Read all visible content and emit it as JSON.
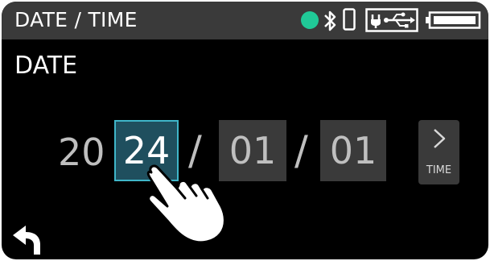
{
  "header": {
    "title": "DATE / TIME",
    "status_dot_color": "#20c997",
    "icons": [
      "status-dot",
      "bluetooth-icon",
      "phone-icon",
      "usb-icon",
      "battery-icon"
    ]
  },
  "main": {
    "label": "DATE",
    "year_prefix": "20",
    "year": "24",
    "separator": "/",
    "month": "01",
    "day": "01",
    "next_label": "TIME",
    "active_field": "year",
    "accent_color": "#3fb6c9"
  },
  "footer": {
    "back_icon": "back-arrow-icon"
  },
  "overlay": {
    "pointer_icon": "hand-pointer-icon"
  }
}
